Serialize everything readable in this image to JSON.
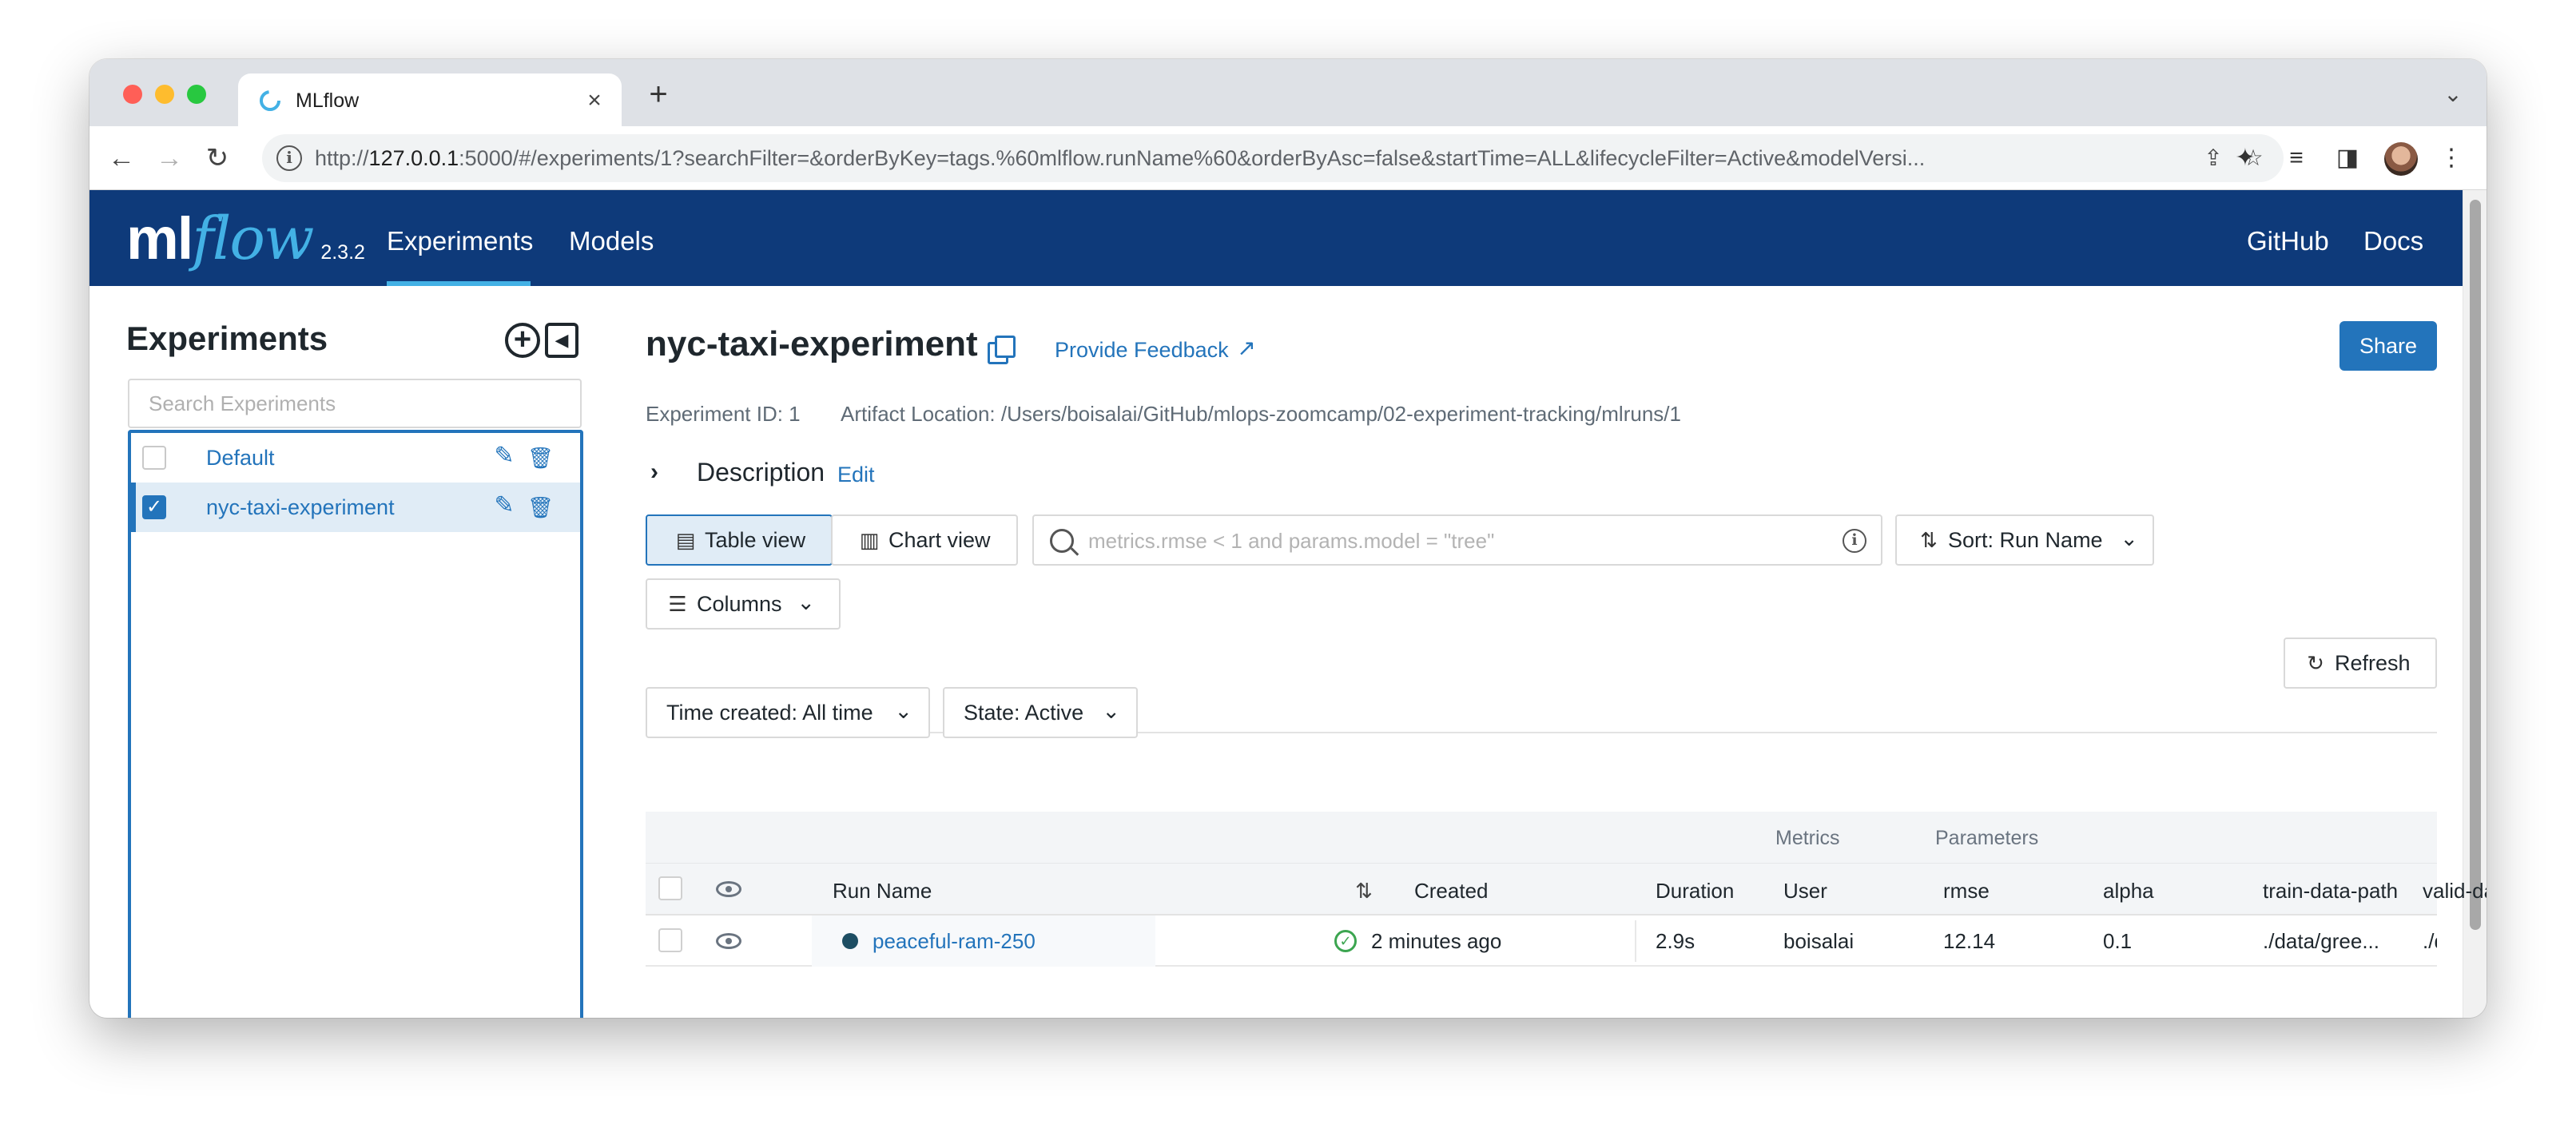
{
  "browser": {
    "tab_title": "MLflow",
    "tab_close": "×",
    "new_tab": "+",
    "tab_menu": "⌄",
    "url_prefix": "http://",
    "url_host": "127.0.0.1",
    "url_rest": ":5000/#/experiments/1?searchFilter=&orderByKey=tags.%60mlflow.runName%60&orderByAsc=false&startTime=ALL&lifecycleFilter=Active&modelVersi...",
    "back_glyph": "←",
    "forward_glyph": "→",
    "reload_glyph": "↻",
    "info_glyph": "i",
    "share_glyph": "⇪",
    "star_glyph": "☆",
    "extensions_glyph": "✦",
    "reading_glyph": "≡",
    "sidepanel_glyph": "◨",
    "menu_glyph": "⋮",
    "colors": {
      "tabstrip": "#dee1e6",
      "omnibox": "#f1f3f4"
    }
  },
  "header": {
    "logo_ml": "ml",
    "logo_flow": "flow",
    "version": "2.3.2",
    "nav": [
      "Experiments",
      "Models"
    ],
    "right_links": [
      "GitHub",
      "Docs"
    ],
    "colors": {
      "background": "#0e3a7a",
      "accent": "#43b1e5"
    }
  },
  "sidebar": {
    "title": "Experiments",
    "add_glyph": "+",
    "collapse_glyph": "◀",
    "search_placeholder": "Search Experiments",
    "edit_glyph": "✎",
    "delete_glyph": "🗑",
    "check_glyph": "✓",
    "experiments": [
      {
        "name": "Default",
        "checked": false
      },
      {
        "name": "nyc-taxi-experiment",
        "checked": true
      }
    ]
  },
  "experiment": {
    "title": "nyc-taxi-experiment",
    "feedback_label": "Provide Feedback",
    "feedback_glyph": "↗",
    "share_label": "Share",
    "id_text": "Experiment ID: 1",
    "artifact_text": "Artifact Location: /Users/boisalai/GitHub/mlops-zoomcamp/02-experiment-tracking/mlruns/1",
    "description_chevron": "›",
    "description_label": "Description",
    "description_edit": "Edit"
  },
  "controls": {
    "table_view": "Table view",
    "chart_view": "Chart view",
    "table_icon": "▤",
    "chart_icon": "▥",
    "search_placeholder": "metrics.rmse < 1 and params.model = \"tree\"",
    "search_info": "i",
    "sort_label": "Sort: Run Name",
    "sort_icon": "⇅",
    "chevron": "⌄",
    "kebab": "⋮",
    "refresh_label": "Refresh",
    "refresh_icon": "↻",
    "columns_label": "Columns",
    "columns_icon": "☰",
    "time_filter": "Time created: All time",
    "state_filter": "State: Active"
  },
  "table": {
    "groups": {
      "metrics": "Metrics",
      "parameters": "Parameters"
    },
    "columns": {
      "run_name": "Run Name",
      "created": "Created",
      "duration": "Duration",
      "user": "User",
      "rmse": "rmse",
      "alpha": "alpha",
      "train": "train-data-path",
      "valid": "valid-data-path"
    },
    "sort_glyph": "⇅",
    "check_glyph": "✓",
    "rows": [
      {
        "run_name": "peaceful-ram-250",
        "created": "2 minutes ago",
        "duration": "2.9s",
        "user": "boisalai",
        "rmse": "12.14",
        "alpha": "0.1",
        "train": "./data/gree...",
        "valid": "./data/gree..."
      }
    ]
  }
}
